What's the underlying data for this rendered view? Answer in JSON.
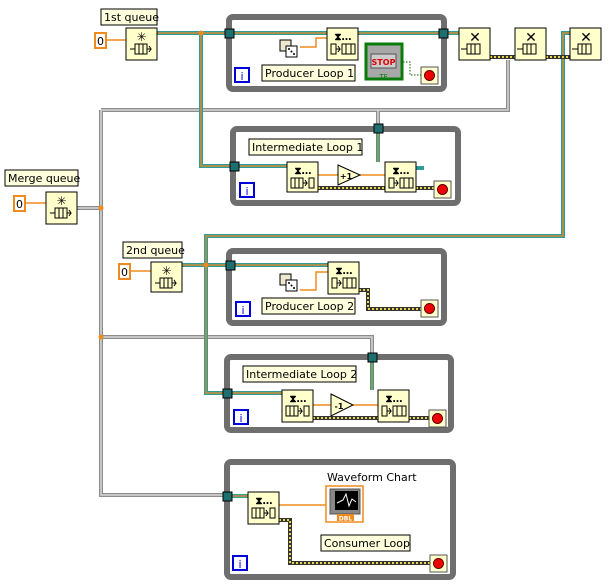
{
  "diagram": {
    "constants": {
      "first_queue_size": "0",
      "merge_queue_size": "0",
      "second_queue_size": "0"
    },
    "labels": {
      "first_queue": "1st queue",
      "merge_queue": "Merge queue",
      "second_queue": "2nd queue",
      "producer_loop_1": "Producer Loop 1",
      "intermediate_loop_1": "Intermediate Loop 1",
      "producer_loop_2": "Producer Loop 2",
      "intermediate_loop_2": "Intermediate Loop 2",
      "consumer_loop": "Consumer Loop",
      "waveform_chart": "Waveform Chart"
    },
    "stop_button": {
      "text": "STOP",
      "type": "TF"
    },
    "chart_type": "DBL",
    "loop_iteration": "i",
    "node_glyphs": {
      "increment": "+1",
      "decrement": "-1",
      "queue_top": "⧗…"
    },
    "colors": {
      "queue_wire": "#2e9c9c",
      "numeric_wire": "#f08a1c",
      "frame": "#6e6e6e",
      "node_bg": "#ffffcc"
    }
  }
}
